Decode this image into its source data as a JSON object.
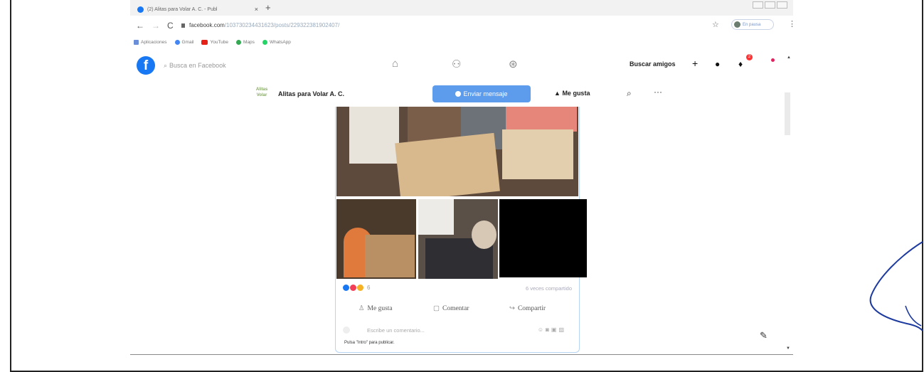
{
  "browser": {
    "tab_title": "(2) Alitas para Volar A. C. - Publ",
    "tab_close": "×",
    "new_tab": "+",
    "url_host": "facebook.com",
    "url_path": "/103730234431623/posts/229322381902407/",
    "profile_label": "En pausa",
    "bookmarks": [
      {
        "label": "Aplicaciones",
        "icon": "apps-grid-icon",
        "color": "#6a8fd8"
      },
      {
        "label": "Gmail",
        "icon": "google-icon",
        "color": "#4285f4"
      },
      {
        "label": "YouTube",
        "icon": "youtube-icon",
        "color": "#e62117"
      },
      {
        "label": "Maps",
        "icon": "maps-pin-icon",
        "color": "#34a853"
      },
      {
        "label": "WhatsApp",
        "icon": "whatsapp-icon",
        "color": "#25d366"
      }
    ]
  },
  "facebook": {
    "logo": "f",
    "search_placeholder": "Busca en Facebook",
    "find_friends": "Buscar amigos",
    "notification_count": "2",
    "brand_color": "#1877f2"
  },
  "page": {
    "name": "Alitas para Volar A. C.",
    "logo_text_top": "Alitas",
    "logo_text_bottom": "Volar",
    "message_button": "Enviar mensaje",
    "like_button": "Me gusta"
  },
  "post": {
    "reaction_count": "6",
    "shares_text": "6 veces compartido",
    "like_label": "Me gusta",
    "comment_label": "Comentar",
    "share_label": "Compartir",
    "comment_placeholder": "Escribe un comentario...",
    "enter_hint": "Pulsa \"Intro\" para publicar."
  }
}
